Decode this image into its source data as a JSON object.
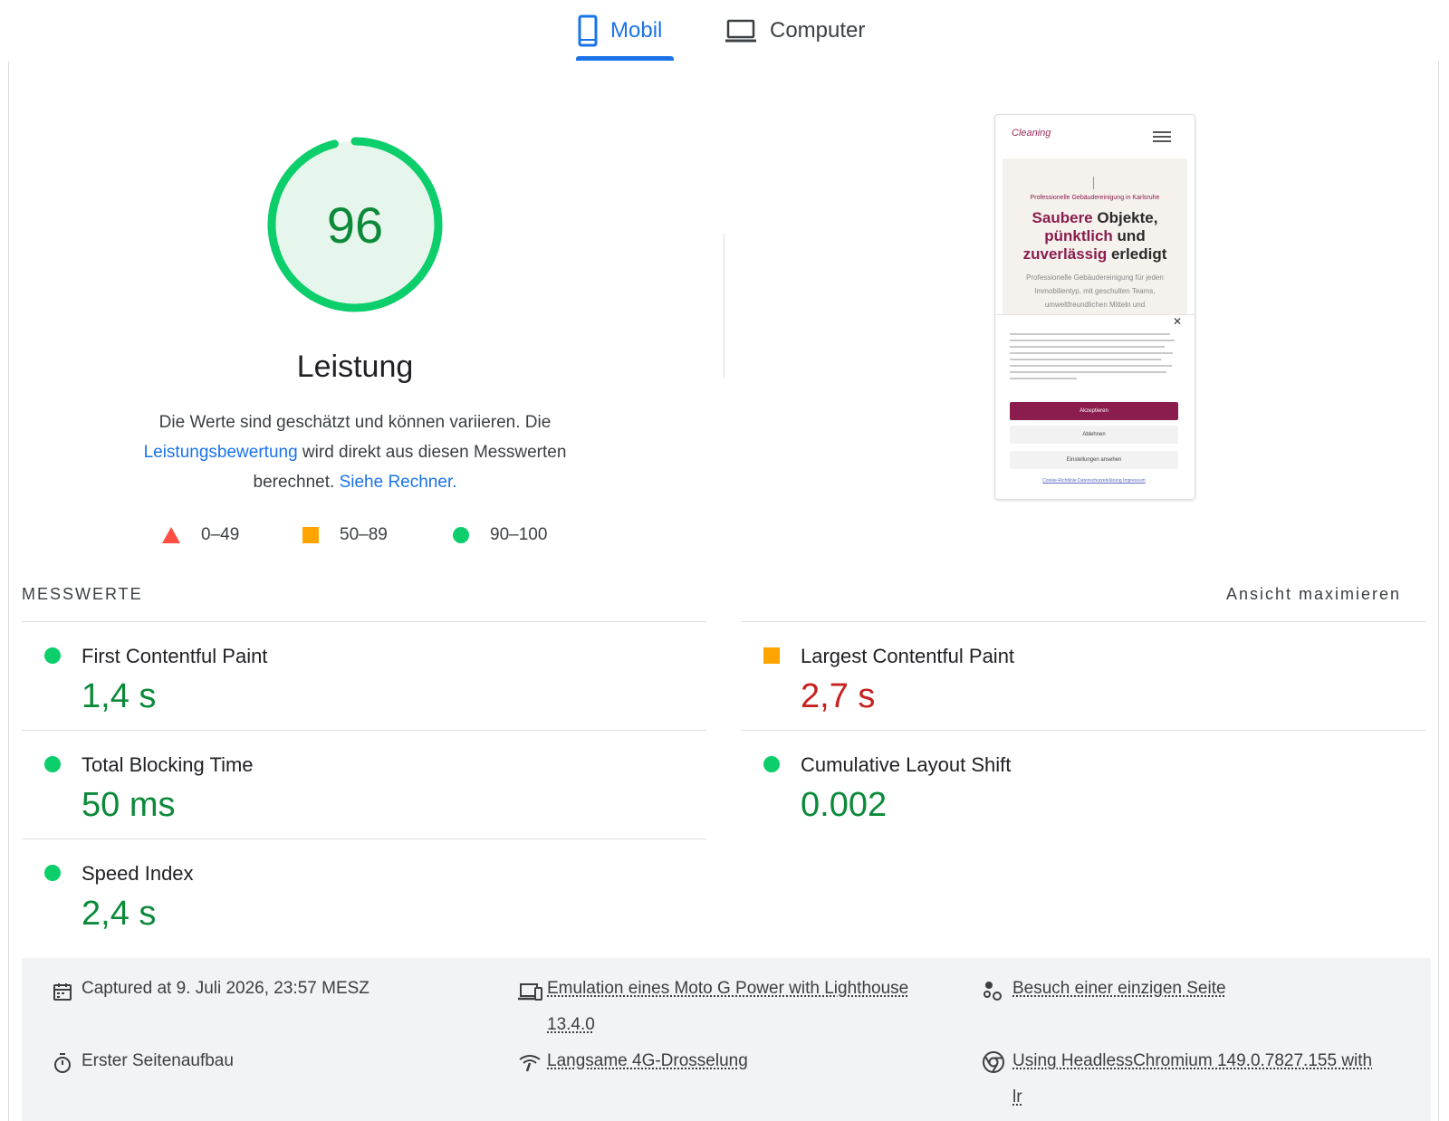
{
  "tabs": {
    "mobile_label": "Mobil",
    "desktop_label": "Computer"
  },
  "performance": {
    "score": "96",
    "score_fraction": 0.96,
    "title": "Leistung",
    "desc_part1": "Die Werte sind geschätzt und können variieren. Die ",
    "desc_link1": "Leistungsbewertung",
    "desc_part2": " wird direkt aus diesen Messwerten berechnet. ",
    "desc_link2": "Siehe Rechner."
  },
  "legend": {
    "poor": "0–49",
    "average": "50–89",
    "good": "90–100"
  },
  "screenshot": {
    "subtitle": "Professionelle Gebäudereinigung in Karlsruhe",
    "headline_accent1": "Saubere",
    "headline_rest1": " Objekte,",
    "headline_accent2": "pünktlich",
    "headline_rest2": " und",
    "headline_accent3": "zuverlässig",
    "headline_rest3": " erledigt",
    "body": "Professionelle Gebäudereinigung für jeden Immobilientyp, mit geschulten Teams, umweltfreundlichen Mitteln und",
    "accept_label": "Akzeptieren",
    "decline_label": "Ablehnen",
    "settings_label": "Einstellungen ansehen",
    "links_label": "Cookie-Richtlinie   Datenschutzerklärung   Impressum"
  },
  "metrics": {
    "section_label": "MESSWERTE",
    "expand_label": "Ansicht maximieren",
    "items": [
      {
        "label": "First Contentful Paint",
        "value": "1,4 s",
        "status": "good"
      },
      {
        "label": "Largest Contentful Paint",
        "value": "2,7 s",
        "status": "average"
      },
      {
        "label": "Total Blocking Time",
        "value": "50 ms",
        "status": "good"
      },
      {
        "label": "Cumulative Layout Shift",
        "value": "0.002",
        "status": "good"
      },
      {
        "label": "Speed Index",
        "value": "2,4 s",
        "status": "good"
      }
    ]
  },
  "footer": {
    "captured": "Captured at 9. Juli 2026, 23:57 MESZ",
    "first_load": "Erster Seitenaufbau",
    "emulation": "Emulation eines Moto G Power with Lighthouse",
    "emulation_version": "13.4.0",
    "throttling": "Langsame 4G-Drosselung",
    "single_page": "Besuch einer einzigen Seite",
    "browser": "Using HeadlessChromium 149.0.7827.155 with",
    "browser_tail": "lr"
  },
  "colors": {
    "accent": "#1a73e8",
    "good": "#0cce6b",
    "good_text": "#0c8a3a",
    "average": "#ffa400",
    "average_text": "#c5221f",
    "poor": "#ff4e42"
  }
}
